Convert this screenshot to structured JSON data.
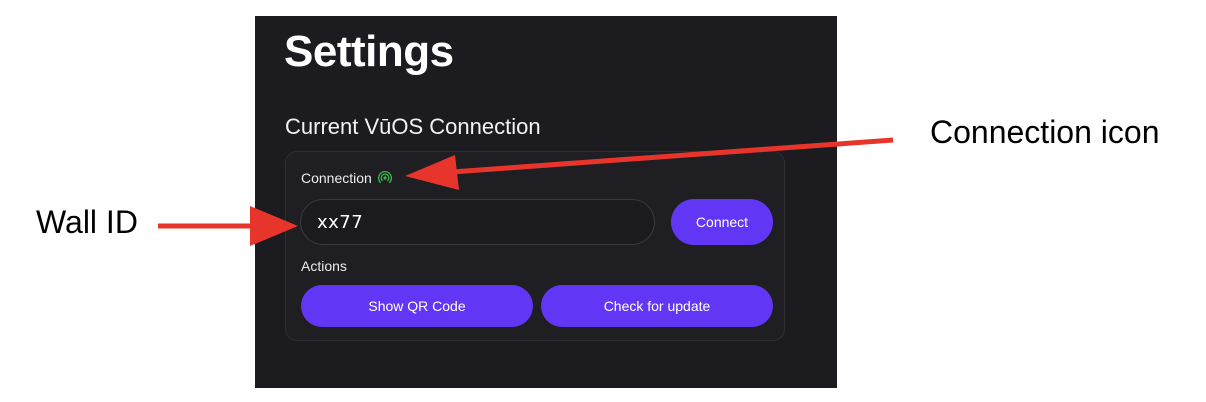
{
  "settings": {
    "title": "Settings",
    "section_title": "Current VūOS Connection",
    "connection_label": "Connection",
    "connection_icon": "wifi-signal-icon",
    "connection_icon_color": "#3fb950",
    "wall_id_value": "xx77",
    "connect_label": "Connect",
    "actions_label": "Actions",
    "show_qr_label": "Show QR Code",
    "check_update_label": "Check for update",
    "accent_color": "#6236f5",
    "background_color": "#1c1b1f"
  },
  "annotations": {
    "connection_icon_label": "Connection icon",
    "wall_id_label": "Wall ID",
    "arrow_color": "#e8352b"
  }
}
